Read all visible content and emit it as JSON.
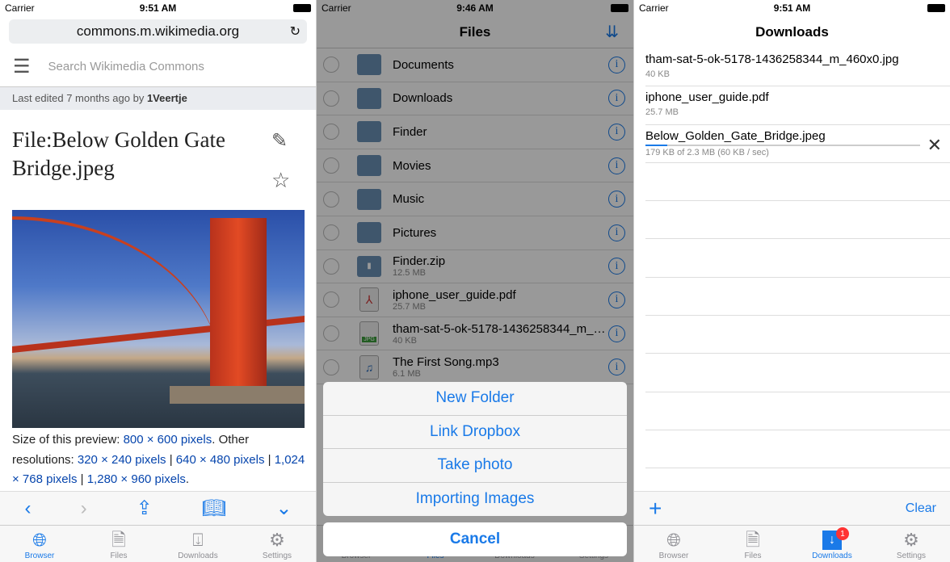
{
  "accent": "#1a7ae8",
  "browser": {
    "status": {
      "carrier": "Carrier",
      "time": "9:51 AM"
    },
    "url": "commons.m.wikimedia.org",
    "search_placeholder": "Search Wikimedia Commons",
    "last_edited_prefix": "Last edited 7 months ago by ",
    "last_edited_user": "1Veertje",
    "title": "File:Below Golden Gate Bridge.jpeg",
    "desc": {
      "prefix": "Size of this preview: ",
      "preview": "800 × 600 pixels",
      "other": ". Other resolutions: ",
      "r1": "320 × 240 pixels",
      "r2": "640 × 480 pixels",
      "r3": "1,024 × 768 pixels",
      "r4": "1,280 × 960 pixels",
      "end": "."
    }
  },
  "files": {
    "status": {
      "carrier": "Carrier",
      "time": "9:46 AM"
    },
    "title": "Files",
    "items": [
      {
        "name": "Documents",
        "size": "",
        "icon": "folder-icon"
      },
      {
        "name": "Downloads",
        "size": "",
        "icon": "folder-icon"
      },
      {
        "name": "Finder",
        "size": "",
        "icon": "folder-icon"
      },
      {
        "name": "Movies",
        "size": "",
        "icon": "folder-icon"
      },
      {
        "name": "Music",
        "size": "",
        "icon": "folder-icon"
      },
      {
        "name": "Pictures",
        "size": "",
        "icon": "folder-icon"
      },
      {
        "name": "Finder.zip",
        "size": "12.5 MB",
        "icon": "zip-icon"
      },
      {
        "name": "iphone_user_guide.pdf",
        "size": "25.7 MB",
        "icon": "pdf-icon"
      },
      {
        "name": "tham-sat-5-ok-5178-1436258344_m_…",
        "size": "40 KB",
        "icon": "jpg-icon"
      },
      {
        "name": "The First Song.mp3",
        "size": "6.1 MB",
        "icon": "music-file-icon"
      }
    ],
    "sheet": [
      "New Folder",
      "Link Dropbox",
      "Take photo",
      "Importing Images"
    ],
    "cancel": "Cancel"
  },
  "downloads": {
    "status": {
      "carrier": "Carrier",
      "time": "9:51 AM"
    },
    "title": "Downloads",
    "items": [
      {
        "name": "tham-sat-5-ok-5178-1436258344_m_460x0.jpg",
        "size": "40 KB"
      },
      {
        "name": "iphone_user_guide.pdf",
        "size": "25.7 MB"
      }
    ],
    "active": {
      "name": "Below_Golden_Gate_Bridge.jpeg",
      "progress_text": "179 KB of 2.3 MB (60 KB / sec)",
      "progress_fraction": 0.078
    },
    "clear": "Clear",
    "badge": "1"
  },
  "tabs": [
    "Browser",
    "Files",
    "Downloads",
    "Settings"
  ]
}
